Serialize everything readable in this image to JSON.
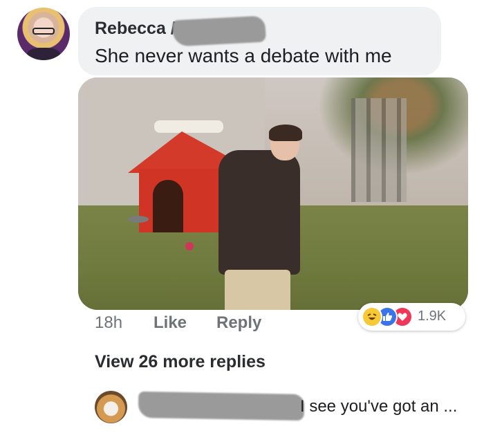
{
  "comment": {
    "author": "Rebecca",
    "author_suffix": "/",
    "text": "She never wants a debate with me",
    "time": "18h",
    "like_label": "Like",
    "reply_label": "Reply",
    "reactions": {
      "icons": [
        "haha-icon",
        "like-icon",
        "love-icon"
      ],
      "count": "1.9K",
      "colors": {
        "haha": "#f7c934",
        "like": "#3b73e8",
        "love": "#f0375a"
      }
    }
  },
  "view_more_replies": "View 26 more replies",
  "reply": {
    "text_preview": "I see you've got an ..."
  }
}
